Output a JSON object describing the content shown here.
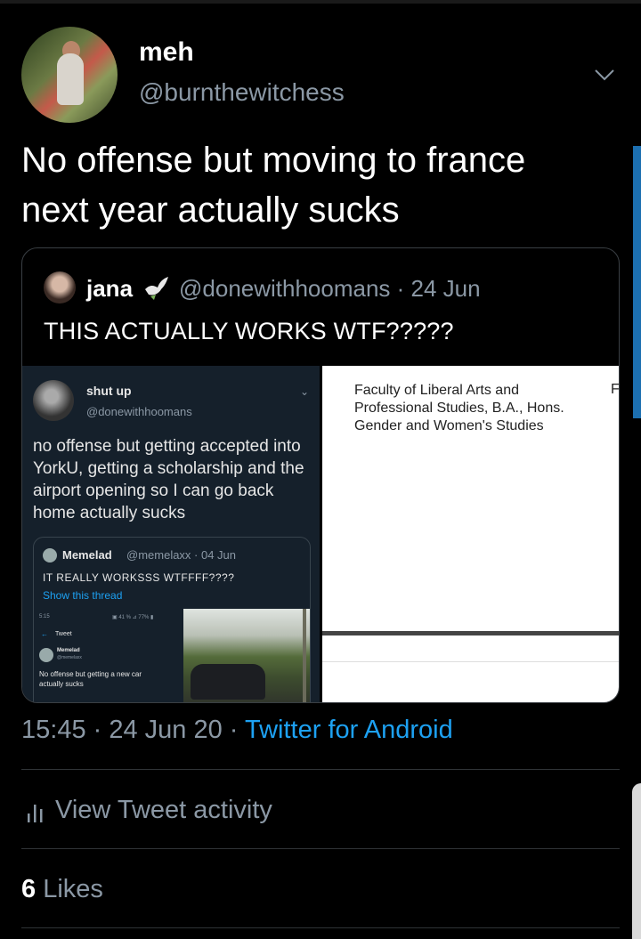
{
  "tweet": {
    "author_name": "meh",
    "author_handle": "@burnthewitchess",
    "text_line1": "No offense but moving to france",
    "text_line2": "next year actually sucks",
    "time_date": "15:45 · 24 Jun 20 · ",
    "source": "Twitter for Android"
  },
  "quoted": {
    "name": "jana",
    "meta": "@donewithhoomans · 24 Jun",
    "text": "THIS ACTUALLY WORKS WTF?????",
    "media_left": {
      "name": "shut up",
      "handle": "@donewithhoomans",
      "text": "no offense but getting accepted into YorkU, getting a scholarship and the airport opening so I can go back home actually sucks",
      "inner_quote": {
        "name": "Memelad",
        "meta": "@memelaxx · 04 Jun",
        "text": "IT REALLY WORKSSS WTFFFF????",
        "thread_link": "Show this thread",
        "mini": {
          "status_time": "5:15",
          "status_icons": "▣ 41 % ⊿ 77% ▮",
          "back": "←",
          "title": "Tweet",
          "name": "Memelad",
          "handle": "@memelaxx",
          "text": "No offense but getting a new car actually sucks"
        }
      }
    },
    "media_right": {
      "text": "Faculty of Liberal Arts and Professional Studies, B.A., Hons. Gender and Women's Studies",
      "edge_letter": "F"
    }
  },
  "actions": {
    "activity_label": "View Tweet activity",
    "likes_count": "6",
    "likes_label": " Likes"
  },
  "colors": {
    "background": "#000000",
    "secondary_text": "#8b98a5",
    "accent": "#1da1f2"
  },
  "icons": [
    "chevron-down-icon",
    "dove-icon",
    "bar-chart-icon"
  ]
}
